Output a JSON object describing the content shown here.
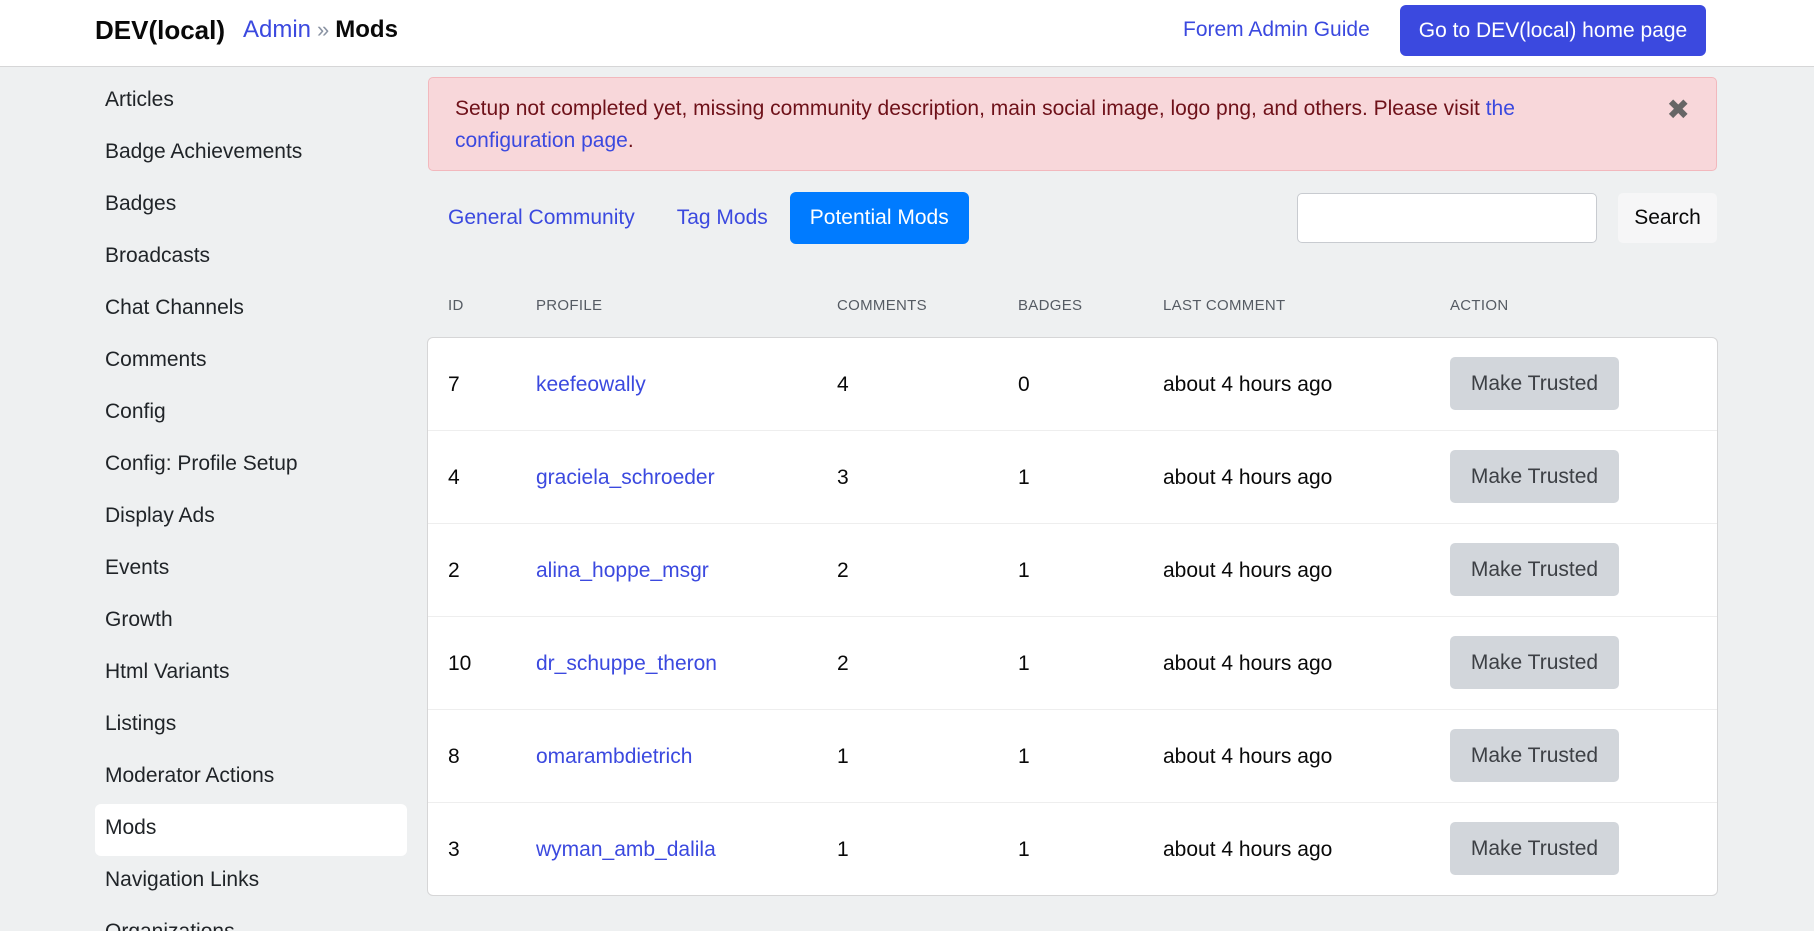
{
  "header": {
    "brand": "DEV(local)",
    "breadcrumb_admin": "Admin",
    "breadcrumb_sep": "»",
    "breadcrumb_current": "Mods",
    "guide_link": "Forem Admin Guide",
    "home_button": "Go to DEV(local) home page"
  },
  "sidebar": {
    "items": [
      {
        "label": "Articles"
      },
      {
        "label": "Badge Achievements"
      },
      {
        "label": "Badges"
      },
      {
        "label": "Broadcasts"
      },
      {
        "label": "Chat Channels"
      },
      {
        "label": "Comments"
      },
      {
        "label": "Config"
      },
      {
        "label": "Config: Profile Setup"
      },
      {
        "label": "Display Ads"
      },
      {
        "label": "Events"
      },
      {
        "label": "Growth"
      },
      {
        "label": "Html Variants"
      },
      {
        "label": "Listings"
      },
      {
        "label": "Moderator Actions"
      },
      {
        "label": "Mods"
      },
      {
        "label": "Navigation Links"
      },
      {
        "label": "Organizations"
      }
    ],
    "active_label": "Mods"
  },
  "alert": {
    "text": "Setup not completed yet, missing community description, main social image, logo png, and others. Please visit ",
    "link": "the configuration page",
    "suffix": ".",
    "close_icon": "✖"
  },
  "tabs": [
    {
      "label": "General Community"
    },
    {
      "label": "Tag Mods"
    },
    {
      "label": "Potential Mods"
    }
  ],
  "search": {
    "value": "",
    "button": "Search"
  },
  "table": {
    "headers": {
      "id": "ID",
      "profile": "PROFILE",
      "comments": "COMMENTS",
      "badges": "BADGES",
      "last_comment": "LAST COMMENT",
      "action": "ACTION"
    },
    "rows": [
      {
        "id": "7",
        "profile": "keefeowally",
        "comments": "4",
        "badges": "0",
        "last_comment": "about 4 hours ago",
        "action": "Make Trusted"
      },
      {
        "id": "4",
        "profile": "graciela_schroeder",
        "comments": "3",
        "badges": "1",
        "last_comment": "about 4 hours ago",
        "action": "Make Trusted"
      },
      {
        "id": "2",
        "profile": "alina_hoppe_msgr",
        "comments": "2",
        "badges": "1",
        "last_comment": "about 4 hours ago",
        "action": "Make Trusted"
      },
      {
        "id": "10",
        "profile": "dr_schuppe_theron",
        "comments": "2",
        "badges": "1",
        "last_comment": "about 4 hours ago",
        "action": "Make Trusted"
      },
      {
        "id": "8",
        "profile": "omarambdietrich",
        "comments": "1",
        "badges": "1",
        "last_comment": "about 4 hours ago",
        "action": "Make Trusted"
      },
      {
        "id": "3",
        "profile": "wyman_amb_dalila",
        "comments": "1",
        "badges": "1",
        "last_comment": "about 4 hours ago",
        "action": "Make Trusted"
      }
    ]
  },
  "colors": {
    "accent": "#3b49df",
    "active_tab": "#007bff",
    "alert_bg": "#f8d7da",
    "page_bg": "#eef0f1"
  }
}
